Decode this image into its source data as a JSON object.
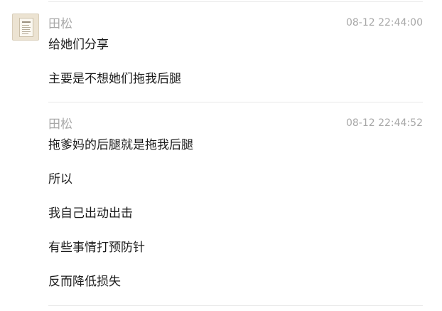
{
  "groups": [
    {
      "sender": "田松",
      "time": "08-12 22:44:00",
      "messages": [
        "给她们分享",
        "主要是不想她们拖我后腿"
      ]
    },
    {
      "sender": "田松",
      "time": "08-12 22:44:52",
      "messages": [
        "拖爹妈的后腿就是拖我后腿",
        "所以",
        "我自己出动出击",
        "有些事情打预防针",
        "反而降低损失"
      ]
    }
  ]
}
